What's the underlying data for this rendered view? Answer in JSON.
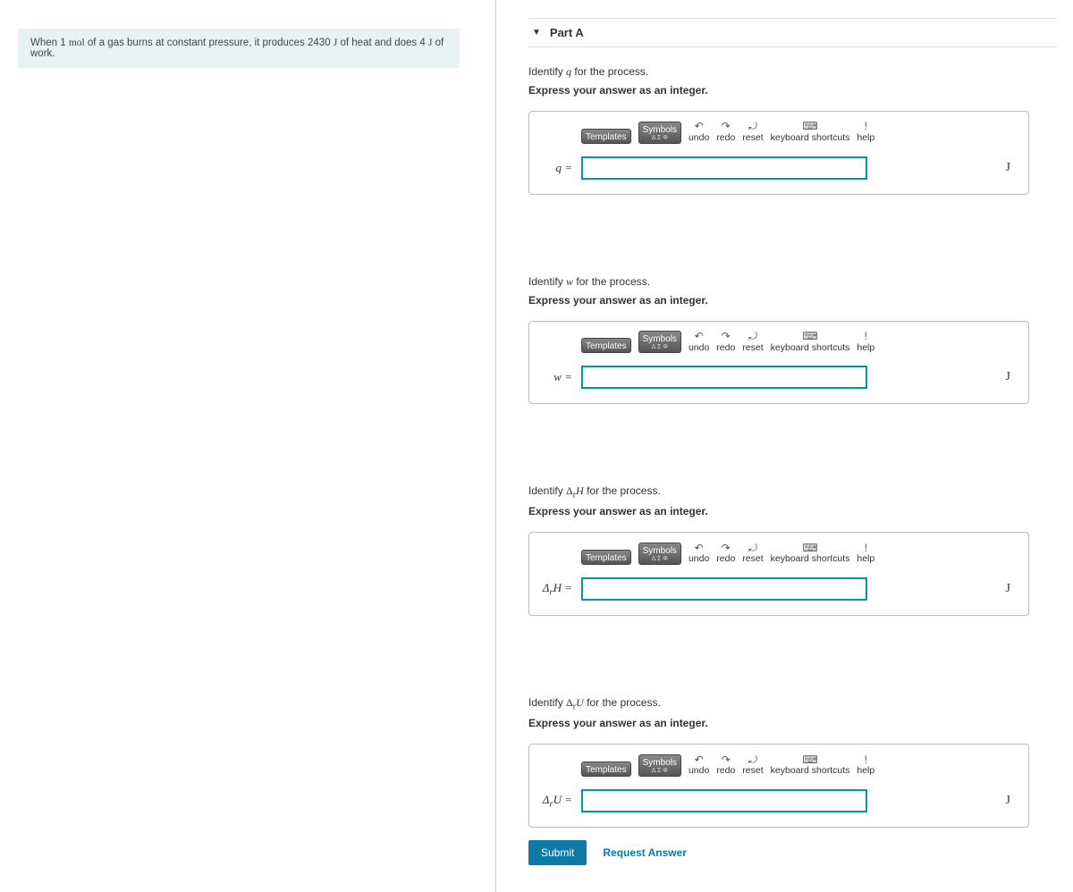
{
  "problem": {
    "pre": "When 1 ",
    "mol": "mol",
    "mid1": " of a gas burns at constant pressure, it produces 2430 ",
    "u1": "J",
    "mid2": " of heat and does 4 ",
    "u2": "J",
    "post": " of work."
  },
  "part": {
    "label": "Part A"
  },
  "toolbar": {
    "templates": "Templates",
    "symbols": "Symbols",
    "sym_sub": "Δ Σ Φ",
    "undo": "undo",
    "redo": "redo",
    "reset": "reset",
    "kbd": "keyboard shortcuts",
    "help": "help"
  },
  "hint": "Express your answer as an integer.",
  "unit": "J",
  "q1": {
    "prompt_pre": "Identify ",
    "var": "q",
    "prompt_post": " for the process.",
    "lhs": "q ="
  },
  "q2": {
    "prompt_pre": "Identify ",
    "var": "w",
    "prompt_post": " for the process.",
    "lhs": "w ="
  },
  "q3": {
    "prompt_pre": "Identify ",
    "var": "Δ_r H",
    "prompt_post": " for the process.",
    "lhs": "Δ_r H ="
  },
  "q4": {
    "prompt_pre": "Identify ",
    "var": "Δ_r U",
    "prompt_post": " for the process.",
    "lhs": "Δ_r U ="
  },
  "actions": {
    "submit": "Submit",
    "request": "Request Answer"
  }
}
